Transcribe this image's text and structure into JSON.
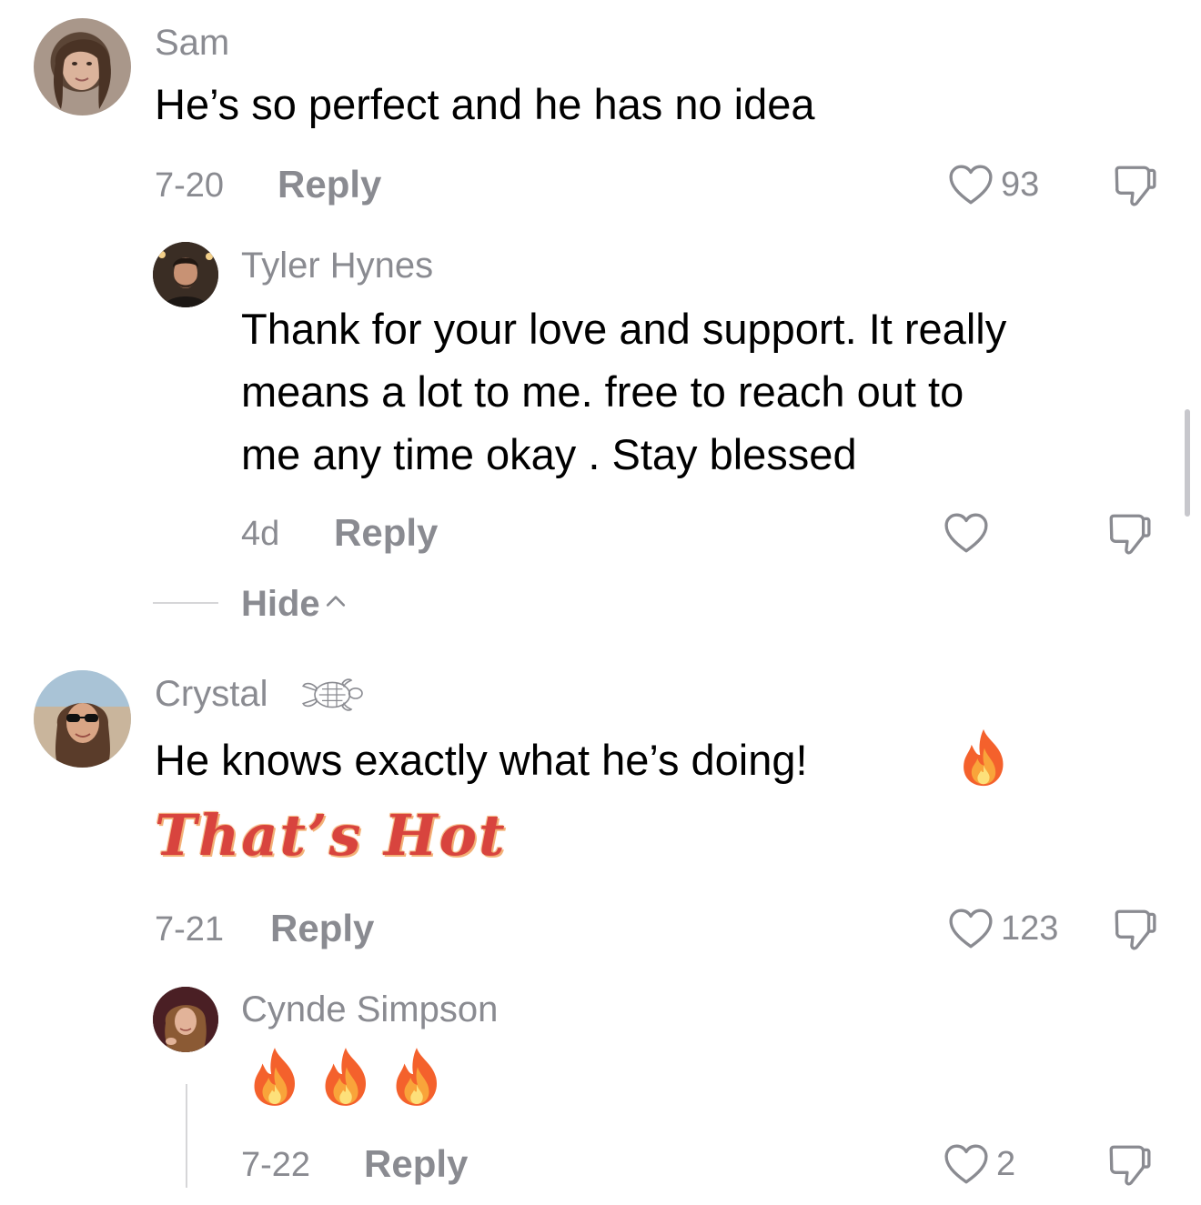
{
  "comments": [
    {
      "username": "Sam",
      "text": "He’s so perfect and he has no idea",
      "date": "7-20",
      "reply_label": "Reply",
      "likes": "93",
      "avatar_icon": "user-avatar",
      "replies": [
        {
          "username": "Tyler Hynes",
          "text_lines": [
            "Thank for your love and support. It really",
            "means a lot to me.  free to reach out to",
            "me any time okay . Stay blessed"
          ],
          "date": "4d",
          "reply_label": "Reply",
          "likes": "",
          "avatar_icon": "user-avatar"
        }
      ],
      "hide_label": "Hide"
    },
    {
      "username": "Crystal",
      "username_badge_icon": "turtle-icon",
      "text": "He knows exactly what he’s doing!",
      "text_emoji": "fire-emoji",
      "sticker_text": "That’s Hot",
      "date": "7-21",
      "reply_label": "Reply",
      "likes": "123",
      "avatar_icon": "user-avatar",
      "replies": [
        {
          "username": "Cynde Simpson",
          "text_emojis": [
            "fire-emoji",
            "fire-emoji",
            "fire-emoji"
          ],
          "date": "7-22",
          "reply_label": "Reply",
          "likes": "2",
          "avatar_icon": "user-avatar"
        }
      ]
    }
  ],
  "colors": {
    "secondary_text": "#8a8b91",
    "primary_text": "#000000",
    "sticker_red": "#d8443e"
  }
}
